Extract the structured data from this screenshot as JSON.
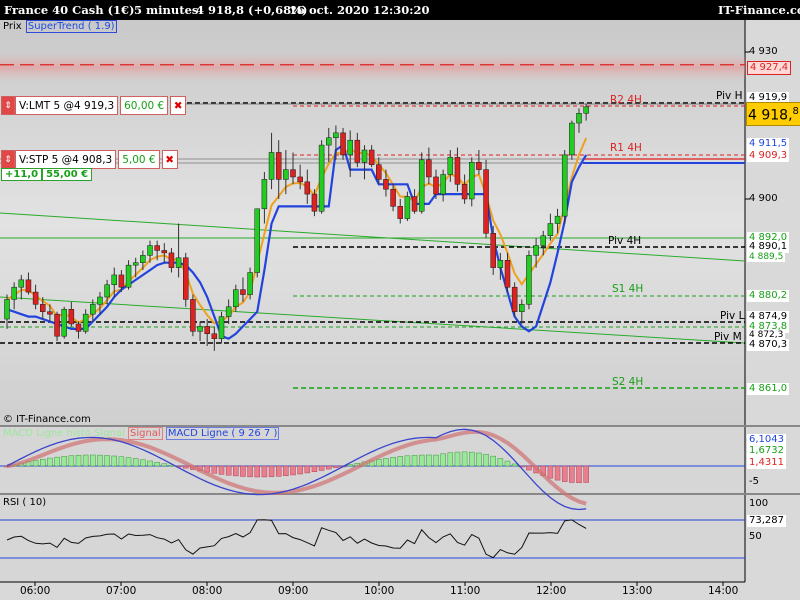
{
  "header": {
    "instrument": "France 40 Cash (1€)",
    "timeframe": "5 minutes",
    "last": "4 918,8 (+0,68%)",
    "datetime": "16 oct. 2020 12:30:20",
    "brand": "IT-Finance.com"
  },
  "legend": {
    "price_label": "Prix",
    "supertrend_label": "SuperTrend ( 1.9)",
    "watermark": "© IT-Finance.com"
  },
  "orders": {
    "lmt": {
      "label": "V:LMT  5 @4 919,3",
      "pnl": "60,00 €",
      "close": "✖"
    },
    "stp": {
      "label": "V:STP  5 @4 908,3",
      "pnl": "5,00 €",
      "close": "✖"
    },
    "position": {
      "qty": "+11,0",
      "pnl": "55,00 €"
    }
  },
  "levels": {
    "r2": "R2 4H",
    "r1": "R1 4H",
    "piv4h": "Piv 4H",
    "s1": "S1 4H",
    "s2": "S2 4H",
    "pivh": "Piv H",
    "pivl": "Piv L",
    "pivm": "Piv M"
  },
  "price_axis": {
    "ticks": [
      "4 930",
      "4 900"
    ],
    "boxes": {
      "p4927": "4 927,4",
      "p4919": "4 919,9",
      "p4911": "4 911,5",
      "p4909": "4 909,3",
      "p4892": "4 892,0",
      "p4890": "4 890,1",
      "p4889": "4 889,5",
      "p4880": "4 880,2",
      "p4874": "4 874,9",
      "p4873": "4 873,8",
      "p4872": "4 872,3",
      "p4870": "4 870,3",
      "p4861": "4 861,0"
    },
    "last_main": "4 918,",
    "last_sup": "8"
  },
  "macd": {
    "title_blurred": "MACD Ligne histo Signal",
    "signal": "Signal",
    "ligne": "MACD Ligne ( 9 26 7 )",
    "ticks": [
      "5",
      "-5"
    ],
    "values": [
      "6,1043",
      "1,6732",
      "1,4311"
    ]
  },
  "rsi": {
    "title": "RSI ( 10)",
    "ticks": [
      "100",
      "50"
    ],
    "value": "73,287"
  },
  "time_axis": [
    "06:00",
    "07:00",
    "08:00",
    "09:00",
    "10:00",
    "11:00",
    "12:00",
    "13:00",
    "14:00"
  ],
  "colors": {
    "up": "#22cc22",
    "down": "#dd2222",
    "supertrend": "#2244dd",
    "orange": "#f0a020",
    "resistance": "#dd2222",
    "support": "#18a018",
    "last_price": "#ffcc00"
  },
  "chart_data": {
    "type": "candlestick",
    "instrument": "France 40 Cash (1€)",
    "interval": "5 minutes",
    "time_ticks": [
      "06:00",
      "07:00",
      "08:00",
      "09:00",
      "10:00",
      "11:00",
      "12:00",
      "13:00",
      "14:00"
    ],
    "candles": [
      [
        4875.5,
        4880.5,
        4873.5,
        4879.5
      ],
      [
        4879.5,
        4883.0,
        4877.5,
        4882.0
      ],
      [
        4882.0,
        4884.5,
        4879.5,
        4883.5
      ],
      [
        4883.5,
        4885.0,
        4880.5,
        4881.0
      ],
      [
        4881.0,
        4882.5,
        4877.5,
        4878.5
      ],
      [
        4878.5,
        4880.0,
        4875.5,
        4877.0
      ],
      [
        4877.0,
        4878.5,
        4875.0,
        4876.5
      ],
      [
        4876.5,
        4877.0,
        4871.0,
        4872.0
      ],
      [
        4872.0,
        4878.0,
        4871.5,
        4877.5
      ],
      [
        4877.5,
        4879.0,
        4874.0,
        4874.5
      ],
      [
        4874.5,
        4875.0,
        4871.5,
        4873.0
      ],
      [
        4873.0,
        4877.5,
        4872.5,
        4876.5
      ],
      [
        4876.5,
        4879.5,
        4875.0,
        4878.5
      ],
      [
        4878.5,
        4881.0,
        4876.5,
        4880.0
      ],
      [
        4880.0,
        4883.5,
        4878.5,
        4882.5
      ],
      [
        4882.5,
        4886.0,
        4880.0,
        4884.5
      ],
      [
        4884.5,
        4885.5,
        4881.0,
        4882.0
      ],
      [
        4882.0,
        4887.5,
        4881.5,
        4886.5
      ],
      [
        4886.5,
        4888.0,
        4884.0,
        4887.0
      ],
      [
        4887.0,
        4889.5,
        4885.5,
        4888.5
      ],
      [
        4888.5,
        4891.5,
        4887.0,
        4890.5
      ],
      [
        4890.5,
        4891.5,
        4887.5,
        4889.5
      ],
      [
        4889.5,
        4891.0,
        4887.0,
        4889.0
      ],
      [
        4889.0,
        4890.0,
        4885.0,
        4886.0
      ],
      [
        4886.0,
        4895.0,
        4884.0,
        4888.0
      ],
      [
        4888.0,
        4889.0,
        4878.0,
        4879.5
      ],
      [
        4879.5,
        4880.5,
        4872.0,
        4873.0
      ],
      [
        4873.0,
        4875.0,
        4871.0,
        4874.0
      ],
      [
        4874.0,
        4875.5,
        4870.0,
        4872.5
      ],
      [
        4872.5,
        4874.0,
        4869.0,
        4871.5
      ],
      [
        4871.5,
        4877.0,
        4870.5,
        4876.0
      ],
      [
        4876.0,
        4879.5,
        4874.5,
        4878.0
      ],
      [
        4878.0,
        4882.5,
        4877.0,
        4881.5
      ],
      [
        4881.5,
        4884.0,
        4879.0,
        4880.5
      ],
      [
        4880.5,
        4886.0,
        4879.5,
        4885.0
      ],
      [
        4885.0,
        4892.0,
        4884.0,
        4898.0
      ],
      [
        4898.0,
        4905.5,
        4895.0,
        4904.0
      ],
      [
        4904.0,
        4913.5,
        4902.0,
        4909.5
      ],
      [
        4909.5,
        4912.0,
        4900.0,
        4904.0
      ],
      [
        4904.0,
        4910.0,
        4901.0,
        4906.0
      ],
      [
        4906.0,
        4909.5,
        4903.0,
        4904.5
      ],
      [
        4904.5,
        4907.0,
        4902.0,
        4903.5
      ],
      [
        4903.5,
        4906.0,
        4899.0,
        4901.0
      ],
      [
        4901.0,
        4902.0,
        4896.5,
        4897.5
      ],
      [
        4897.5,
        4912.0,
        4897.0,
        4911.0
      ],
      [
        4911.0,
        4914.5,
        4907.5,
        4912.5
      ],
      [
        4912.5,
        4915.0,
        4908.0,
        4913.5
      ],
      [
        4913.5,
        4914.5,
        4908.0,
        4909.0
      ],
      [
        4909.0,
        4914.0,
        4904.5,
        4912.0
      ],
      [
        4912.0,
        4913.5,
        4906.5,
        4907.5
      ],
      [
        4907.5,
        4911.0,
        4904.0,
        4910.0
      ],
      [
        4910.0,
        4911.0,
        4906.5,
        4907.0
      ],
      [
        4907.0,
        4908.5,
        4903.0,
        4904.0
      ],
      [
        4904.0,
        4906.0,
        4900.5,
        4902.0
      ],
      [
        4902.0,
        4903.0,
        4897.5,
        4898.5
      ],
      [
        4898.5,
        4900.0,
        4895.0,
        4896.0
      ],
      [
        4896.0,
        4901.5,
        4895.5,
        4900.5
      ],
      [
        4900.5,
        4902.0,
        4897.0,
        4897.5
      ],
      [
        4897.5,
        4909.5,
        4897.0,
        4908.0
      ],
      [
        4908.0,
        4910.5,
        4903.0,
        4904.5
      ],
      [
        4904.5,
        4906.0,
        4900.0,
        4901.0
      ],
      [
        4901.0,
        4906.0,
        4899.5,
        4905.0
      ],
      [
        4905.0,
        4910.0,
        4903.5,
        4908.5
      ],
      [
        4908.5,
        4910.5,
        4901.5,
        4903.0
      ],
      [
        4903.0,
        4905.0,
        4899.0,
        4900.0
      ],
      [
        4900.0,
        4908.5,
        4898.5,
        4907.5
      ],
      [
        4907.5,
        4910.0,
        4905.0,
        4906.0
      ],
      [
        4906.0,
        4908.0,
        4892.0,
        4893.0
      ],
      [
        4893.0,
        4894.5,
        4884.5,
        4886.0
      ],
      [
        4886.0,
        4889.0,
        4883.5,
        4887.5
      ],
      [
        4887.5,
        4889.0,
        4881.0,
        4882.0
      ],
      [
        4882.0,
        4883.0,
        4876.0,
        4877.0
      ],
      [
        4877.0,
        4879.5,
        4874.5,
        4878.5
      ],
      [
        4878.5,
        4889.5,
        4877.5,
        4888.5
      ],
      [
        4888.5,
        4892.0,
        4886.0,
        4890.5
      ],
      [
        4890.5,
        4893.5,
        4888.5,
        4892.5
      ],
      [
        4892.5,
        4897.0,
        4891.5,
        4895.0
      ],
      [
        4895.0,
        4898.0,
        4893.0,
        4896.5
      ],
      [
        4896.5,
        4910.0,
        4895.0,
        4909.0
      ],
      [
        4909.0,
        4916.0,
        4908.0,
        4915.5
      ],
      [
        4915.5,
        4918.5,
        4913.5,
        4917.5
      ],
      [
        4917.5,
        4919.5,
        4916.0,
        4918.8
      ]
    ],
    "supertrend": [
      4877.5,
      4877.0,
      4876.5,
      4876.0,
      4876.0,
      4875.5,
      4875.0,
      4874.5,
      4874.0,
      4873.5,
      4873.5,
      4873.5,
      4875.0,
      4876.5,
      4878.0,
      4880.0,
      4881.5,
      4882.5,
      4883.5,
      4884.5,
      4885.5,
      4886.5,
      4887.0,
      4887.0,
      4887.0,
      4886.5,
      4885.0,
      4883.0,
      4880.0,
      4876.0,
      4872.0,
      4871.5,
      4872.5,
      4874.0,
      4875.5,
      4877.0,
      4885.5,
      4895.0,
      4898.5,
      4898.5,
      4898.5,
      4898.5,
      4898.5,
      4898.5,
      4898.5,
      4898.5,
      4910.0,
      4911.0,
      4906.0,
      4906.0,
      4906.0,
      4906.0,
      4903.0,
      4903.0,
      4903.0,
      4903.0,
      4903.0,
      4899.0,
      4899.0,
      4899.0,
      4901.0,
      4901.0,
      4901.0,
      4901.0,
      4901.0,
      4901.0,
      4901.0,
      4901.0,
      4892.0,
      4886.0,
      4881.0,
      4876.0,
      4874.0,
      4873.0,
      4874.0,
      4878.5,
      4883.0,
      4889.0,
      4895.5,
      4903.5,
      4906.5,
      4909.0
    ],
    "levels": {
      "red_zone": 4927.4,
      "R2 4H": 4919.3,
      "Piv H": 4919.9,
      "R1 4H": 4910.5,
      "Piv 4H": 4890.1,
      "S1 4H": 4880.2,
      "Piv L": 4874.9,
      "Piv M": 4870.3,
      "S2 4H": 4861.0,
      "blue_line": 4909.0,
      "stop_line": 4908.3,
      "gray_line": 4911.5
    },
    "macd": {
      "macd": 6.1043,
      "signal": 1.6732,
      "histogram": 1.4311
    },
    "rsi": 73.287,
    "last": 4918.8
  }
}
